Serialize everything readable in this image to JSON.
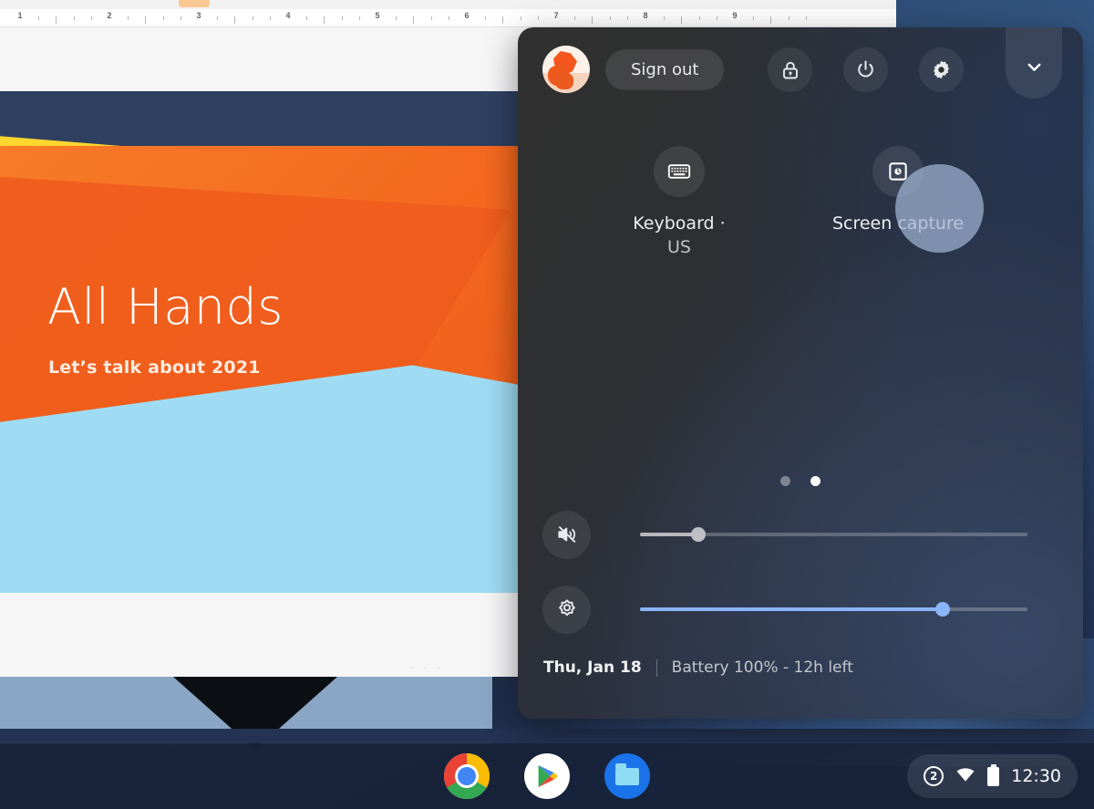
{
  "document_window": {
    "ruler": {
      "numbers": [
        "1",
        "2",
        "3",
        "4",
        "5",
        "6",
        "7",
        "8",
        "9"
      ]
    },
    "slide": {
      "title": "All Hands",
      "subtitle": "Let’s talk about 2021"
    },
    "footer_dots": "· · ·"
  },
  "quick_settings": {
    "avatar_name": "user-avatar",
    "sign_out_label": "Sign out",
    "lock_icon": "lock-icon",
    "power_icon": "power-icon",
    "settings_icon": "gear-icon",
    "collapse_icon": "chevron-down-icon",
    "tiles": [
      {
        "icon": "keyboard-icon",
        "label_line1": "Keyboard ·",
        "label_line2": "US"
      },
      {
        "icon": "screen-capture-icon",
        "label_line1": "Screen capture",
        "label_line2": ""
      }
    ],
    "pagination": {
      "total": 2,
      "active_index": 1
    },
    "sliders": [
      {
        "name": "volume",
        "icon": "volume-muted-icon",
        "value_percent": 15,
        "fill_color": "#ffffff8c",
        "thumb_color": "#bdc1c6"
      },
      {
        "name": "brightness",
        "icon": "brightness-icon",
        "value_percent": 78,
        "fill_color": "#8ab4f8",
        "thumb_color": "#8ab4f8"
      }
    ],
    "footer": {
      "date": "Thu, Jan 18",
      "battery": "Battery 100% - 12h left"
    }
  },
  "shelf": {
    "apps": [
      {
        "name": "chrome",
        "label": "Chrome"
      },
      {
        "name": "play-store",
        "label": "Play Store"
      },
      {
        "name": "files",
        "label": "Files"
      }
    ],
    "status": {
      "notification_count": "2",
      "network_icon": "wifi-icon",
      "battery_icon": "battery-icon",
      "time": "12:30"
    }
  },
  "colors": {
    "accent_blue": "#8ab4f8",
    "panel_dark": "#2e2f31",
    "panel_navy": "#232a3a",
    "shelf": "#172137"
  }
}
